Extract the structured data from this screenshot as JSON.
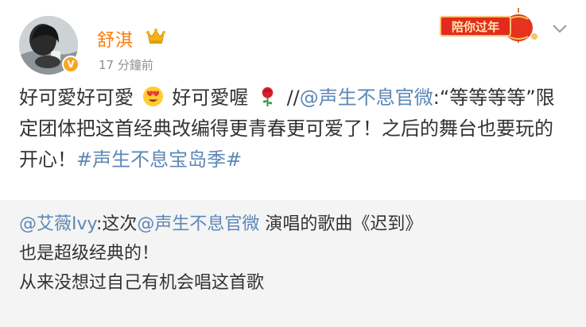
{
  "post": {
    "username": "舒淇",
    "timestamp": "17 分鐘前",
    "verified_badge": "V",
    "promo_label": "陪你过年",
    "content": {
      "text1": "好可愛好可愛",
      "emoji1": "heart-eyes-emoji",
      "text2": "好可愛喔",
      "emoji2": "rose-emoji",
      "sep": "//",
      "mention": "@声生不息官微",
      "quote1": ":“等等等等”限定团体把这首经典改编得更青春更可爱了！之后的舞台也要玩的开心！",
      "hashtag": "#声生不息宝岛季#"
    }
  },
  "repost": {
    "author_mention": "@艾薇Ivy",
    "text1": ":这次",
    "mention2": "@声生不息官微",
    "text2": " 演唱的歌曲《迟到》",
    "line2": "也是超级经典的！",
    "line3": "从来没想过自己有机会唱这首歌"
  },
  "colors": {
    "link": "#5d87b7",
    "username": "#ff7a00",
    "repost_bg": "#f4f4f4"
  },
  "icons": {
    "crown": "crown-icon",
    "chevron": "chevron-down-icon",
    "lantern": "lantern-icon"
  }
}
